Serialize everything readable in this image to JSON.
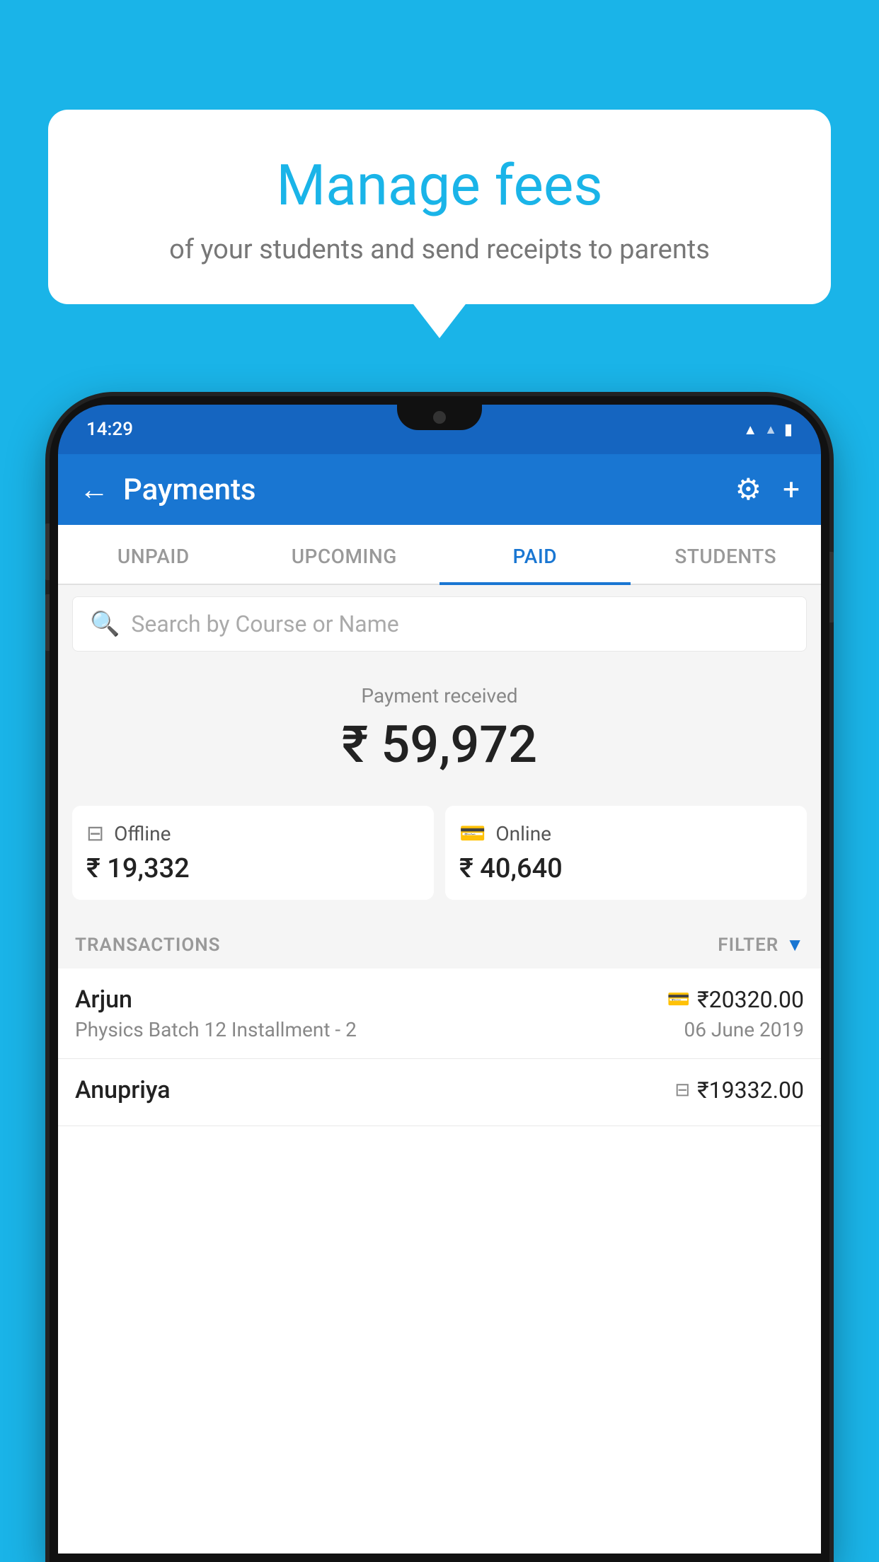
{
  "background_color": "#1ab4e8",
  "bubble": {
    "title": "Manage fees",
    "subtitle": "of your students and send receipts to parents"
  },
  "status_bar": {
    "time": "14:29",
    "icons": [
      "wifi",
      "signal",
      "battery"
    ]
  },
  "header": {
    "title": "Payments",
    "back_label": "←",
    "settings_label": "⚙",
    "add_label": "+"
  },
  "tabs": [
    {
      "label": "UNPAID",
      "active": false
    },
    {
      "label": "UPCOMING",
      "active": false
    },
    {
      "label": "PAID",
      "active": true
    },
    {
      "label": "STUDENTS",
      "active": false
    }
  ],
  "search": {
    "placeholder": "Search by Course or Name"
  },
  "payment_summary": {
    "received_label": "Payment received",
    "total_amount": "₹ 59,972",
    "offline": {
      "label": "Offline",
      "amount": "₹ 19,332"
    },
    "online": {
      "label": "Online",
      "amount": "₹ 40,640"
    }
  },
  "transactions": {
    "header_label": "TRANSACTIONS",
    "filter_label": "FILTER",
    "items": [
      {
        "name": "Arjun",
        "course": "Physics Batch 12 Installment - 2",
        "amount": "₹20320.00",
        "date": "06 June 2019",
        "payment_type": "online"
      },
      {
        "name": "Anupriya",
        "course": "",
        "amount": "₹19332.00",
        "date": "",
        "payment_type": "offline"
      }
    ]
  }
}
